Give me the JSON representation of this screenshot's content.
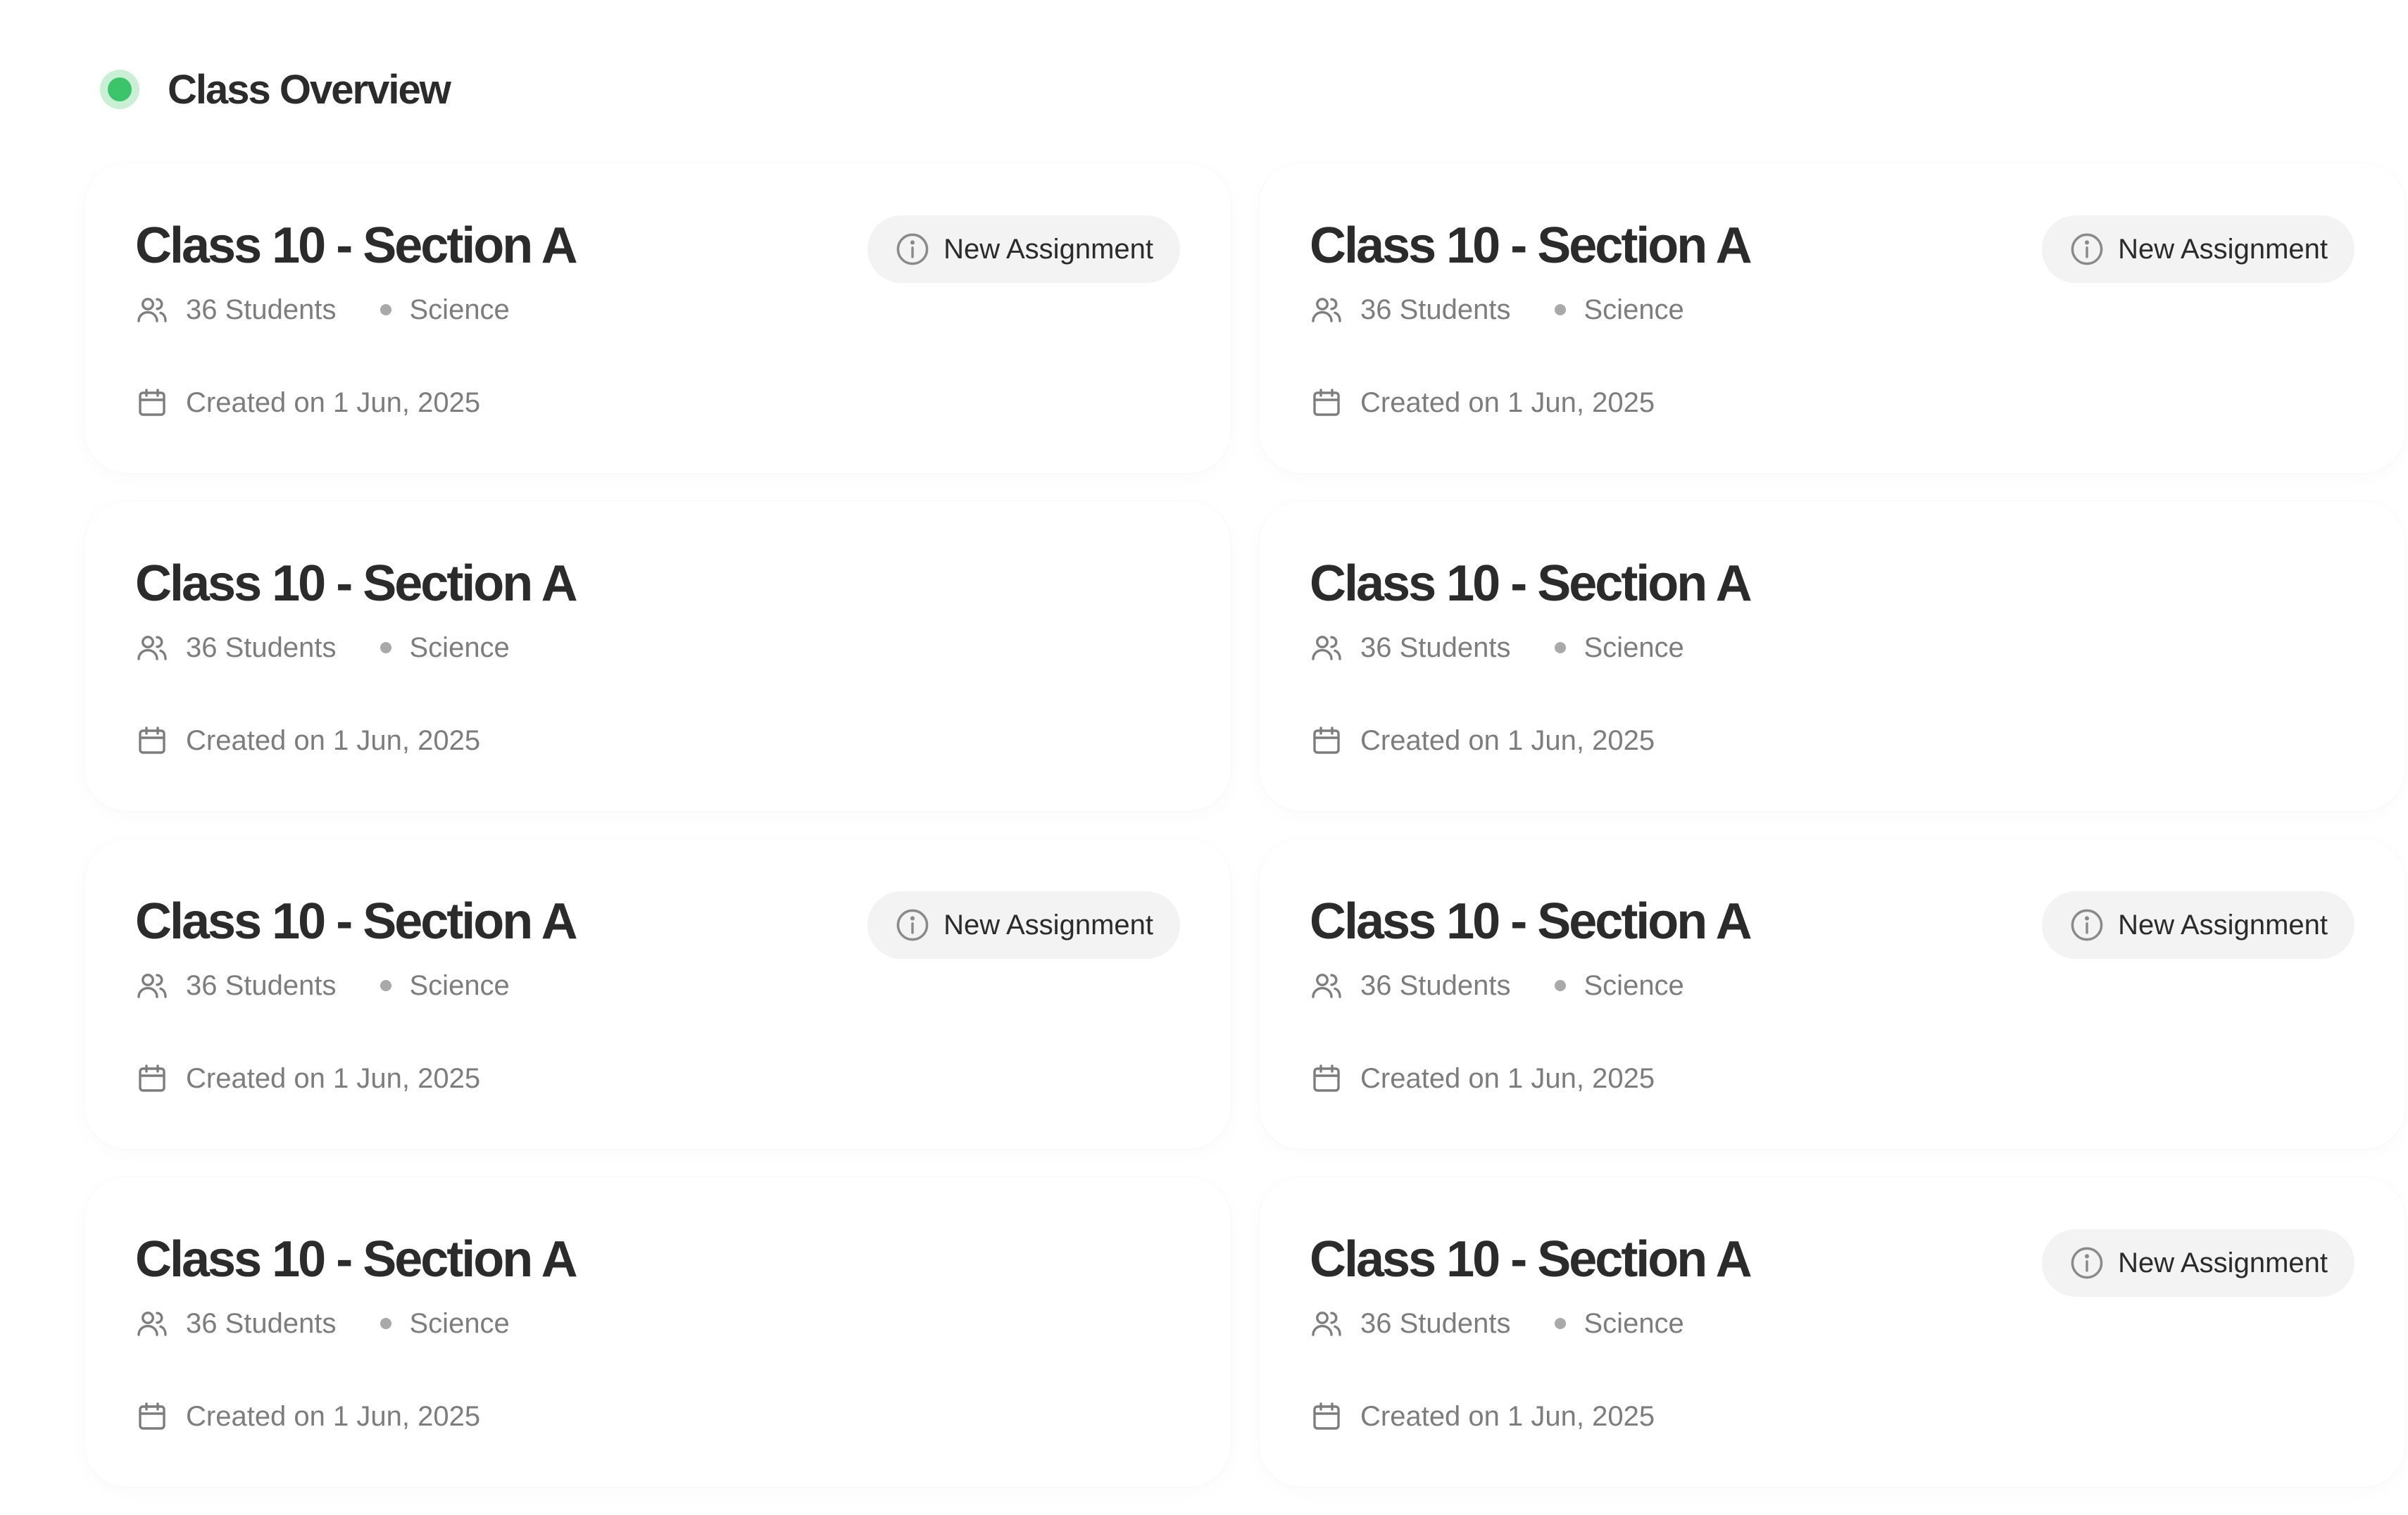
{
  "header": {
    "title": "Class Overview"
  },
  "colors": {
    "status_green": "#3cc46b",
    "status_green_halo": "#c9efd5",
    "pill_bg": "#f3f3f3",
    "muted_text": "#7d7d7d",
    "title_text": "#2b2b2b"
  },
  "cards": [
    {
      "title": "Class 10 - Section A",
      "students": "36 Students",
      "subject": "Science",
      "created": "Created on 1 Jun, 2025",
      "badge": "New Assignment"
    },
    {
      "title": "Class 10 - Section A",
      "students": "36 Students",
      "subject": "Science",
      "created": "Created on 1 Jun, 2025",
      "badge": "New Assignment"
    },
    {
      "title": "Class 10 - Section A",
      "students": "36 Students",
      "subject": "Science",
      "created": "Created on 1 Jun, 2025",
      "badge": null
    },
    {
      "title": "Class 10 - Section A",
      "students": "36 Students",
      "subject": "Science",
      "created": "Created on 1 Jun, 2025",
      "badge": null
    },
    {
      "title": "Class 10 - Section A",
      "students": "36 Students",
      "subject": "Science",
      "created": "Created on 1 Jun, 2025",
      "badge": "New Assignment"
    },
    {
      "title": "Class 10 - Section A",
      "students": "36 Students",
      "subject": "Science",
      "created": "Created on 1 Jun, 2025",
      "badge": "New Assignment"
    },
    {
      "title": "Class 10 - Section A",
      "students": "36 Students",
      "subject": "Science",
      "created": "Created on 1 Jun, 2025",
      "badge": null
    },
    {
      "title": "Class 10 - Section A",
      "students": "36 Students",
      "subject": "Science",
      "created": "Created on 1 Jun, 2025",
      "badge": "New Assignment"
    }
  ],
  "icons": {
    "students": "users-icon",
    "date": "calendar-icon",
    "badge": "info-icon",
    "status": "status-dot-icon"
  }
}
